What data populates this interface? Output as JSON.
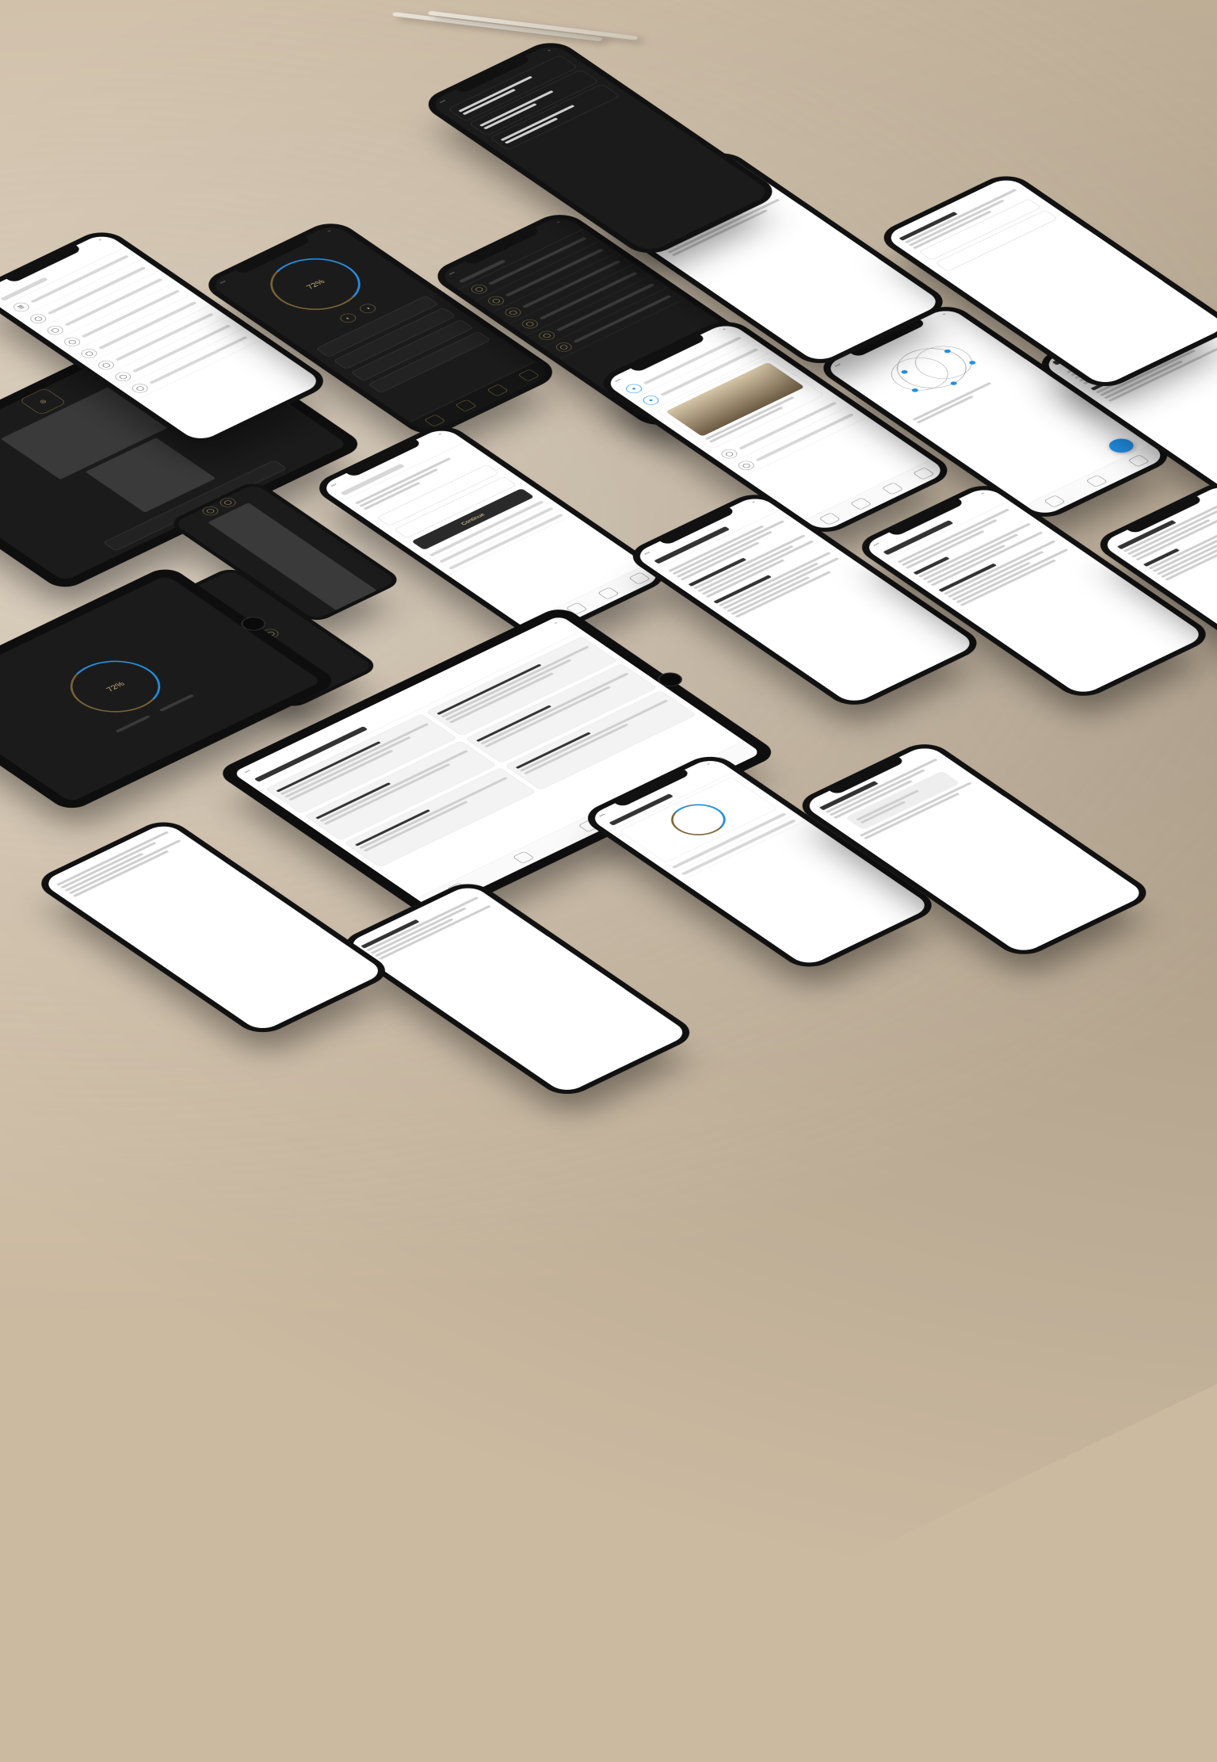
{
  "scene": {
    "description": "Isometric arrangement of phone and tablet device mockups on a beige surface with two styluses, displaying light and dark application screens (dashboards, lists, article views, forms, charts).",
    "background_color": "#cbb9a0",
    "stylus_count": 2
  },
  "colors": {
    "device_body": "#111111",
    "light_bg": "#ffffff",
    "dark_bg": "#1b1b1b",
    "gold_accent": "#c9b27a",
    "blue_accent": "#1f8fe5"
  },
  "devices": [
    {
      "kind": "tablet",
      "theme": "dark",
      "screen": "hero",
      "note": "dark welcome card with gold icon, text, input bar"
    },
    {
      "kind": "tablet",
      "theme": "dark",
      "screen": "ring",
      "note": "dark dashboard with blue/gold circular gauge"
    },
    {
      "kind": "tablet",
      "theme": "light",
      "screen": "doc-grid",
      "note": "light two-column text layout"
    },
    {
      "kind": "phone",
      "theme": "light",
      "screen": "settings-list",
      "note": "list of rows with circular icons"
    },
    {
      "kind": "phone",
      "theme": "dark",
      "screen": "dash-ring",
      "note": "dark phone dashboard with central ring and field rows"
    },
    {
      "kind": "phone",
      "theme": "dark",
      "screen": "list-dark",
      "note": "dark list with gold outline icons"
    },
    {
      "kind": "phone",
      "theme": "light",
      "screen": "feed",
      "note": "light feed with photo card and rows, blue accents"
    },
    {
      "kind": "phone",
      "theme": "light",
      "screen": "form",
      "note": "light form with inputs and dark button"
    },
    {
      "kind": "phone",
      "theme": "light",
      "screen": "article",
      "note": "light document with many text lines and headings"
    },
    {
      "kind": "phone",
      "theme": "light",
      "screen": "article",
      "note": "second light article screen"
    },
    {
      "kind": "phone",
      "theme": "light",
      "screen": "article",
      "note": "third light article screen"
    },
    {
      "kind": "phone",
      "theme": "light",
      "screen": "diagram",
      "note": "light screen with circular intersecting diagram and blue dots, floating action button"
    },
    {
      "kind": "phone",
      "theme": "light",
      "screen": "chart-bottom",
      "note": "light bottom sheet with small chart/gauge"
    },
    {
      "kind": "phone",
      "theme": "dark",
      "screen": "cards-dark",
      "note": "dark phone with stacked outlined cards"
    },
    {
      "kind": "phone_small",
      "theme": "dark",
      "screen": "icons",
      "note": "small dark phone with two circular icons"
    },
    {
      "kind": "phone_small",
      "theme": "dark",
      "screen": "icons2",
      "note": "small dark phone, cropped, two gold icons"
    },
    {
      "kind": "phone",
      "theme": "light",
      "screen": "article",
      "note": "partial light article at edge"
    },
    {
      "kind": "phone",
      "theme": "light",
      "screen": "article",
      "note": "partial light article lower-right"
    }
  ],
  "label": {
    "ring_center": "72%",
    "button": "Continue"
  }
}
